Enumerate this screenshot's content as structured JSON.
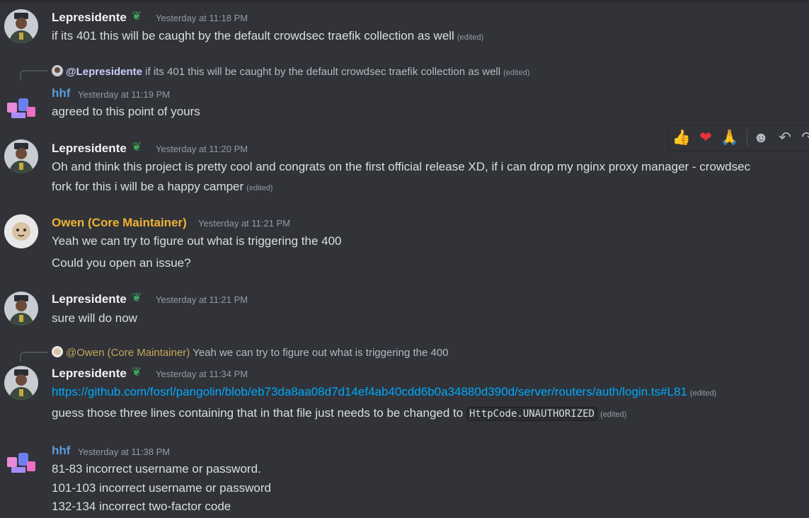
{
  "messages": [
    {
      "author": "Lepresidente",
      "color": "#f2f3f5",
      "time": "Yesterday at 11:18 PM",
      "lines": [
        "if its 401 this will be caught by the default crowdsec traefik collection as well"
      ],
      "edited": "(edited)"
    },
    {
      "reply": {
        "mention": "@Lepresidente",
        "text": "if its 401 this will be caught by the default crowdsec traefik collection as well",
        "edited": "(edited)"
      },
      "author": "hhf",
      "color": "#5b9ad9",
      "time": "Yesterday at 11:19 PM",
      "lines": [
        "agreed to this point of yours"
      ]
    },
    {
      "author": "Lepresidente",
      "color": "#f2f3f5",
      "time": "Yesterday at 11:20 PM",
      "lines": [
        "Oh and think this project is pretty cool and congrats on the first official release XD, if i can drop my nginx proxy manager - crowdsec",
        "fork for this i will be a happy camper"
      ],
      "edited": "(edited)"
    },
    {
      "author": "Owen (Core Maintainer)",
      "color": "#f0b232",
      "time": "Yesterday at 11:21 PM",
      "lines": [
        "Yeah we can try to figure out what is triggering the 400",
        "Could you open an issue?"
      ]
    },
    {
      "author": "Lepresidente",
      "color": "#f2f3f5",
      "time": "Yesterday at 11:21 PM",
      "lines": [
        "sure will do now"
      ]
    },
    {
      "reply": {
        "mention": "@Owen (Core Maintainer)",
        "text": "Yeah we can try to figure out what is triggering the 400"
      },
      "author": "Lepresidente",
      "color": "#f2f3f5",
      "time": "Yesterday at 11:34 PM",
      "link": "https://github.com/fosrl/pangolin/blob/eb73da8aa08d7d14ef4ab40cdd6b0a34880d390d/server/routers/auth/login.ts#L81",
      "link_edited": "(edited)",
      "text": "guess those three lines containing that in that file just needs to be changed to",
      "code": "HttpCode.UNAUTHORIZED",
      "text_edited": "(edited)"
    },
    {
      "author": "hhf",
      "color": "#5b9ad9",
      "time": "Yesterday at 11:38 PM",
      "lines": [
        "81-83 incorrect username or password.",
        "101-103 incorrect username or password",
        "132-134 incorrect two-factor code"
      ]
    }
  ],
  "toolbar": {
    "reactions": [
      "thumbs-up",
      "heart",
      "pray"
    ],
    "icons": [
      "add-reaction-icon",
      "reply-icon",
      "forward-icon"
    ]
  }
}
